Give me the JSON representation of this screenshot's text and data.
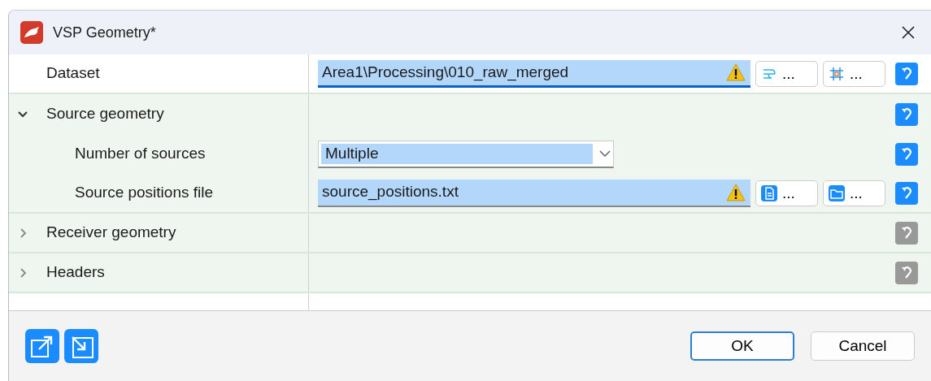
{
  "window": {
    "title": "VSP Geometry*"
  },
  "rows": [
    {
      "kind": "path",
      "label": "Dataset",
      "value": "Area1\\Processing\\010_raw_merged",
      "focused": true,
      "warning": true,
      "buttons": [
        {
          "kind": "filter",
          "label": "..."
        },
        {
          "kind": "crop",
          "label": "..."
        }
      ],
      "reset_enabled": true
    },
    {
      "kind": "group",
      "label": "Source geometry",
      "expanded": true,
      "reset_enabled": true,
      "children": [
        {
          "kind": "select",
          "label": "Number of sources",
          "value": "Multiple",
          "reset_enabled": true
        },
        {
          "kind": "path",
          "label": "Source positions file",
          "value": "source_positions.txt",
          "focused": false,
          "warning": true,
          "buttons": [
            {
              "kind": "file",
              "label": "..."
            },
            {
              "kind": "folder",
              "label": "..."
            }
          ],
          "reset_enabled": true
        }
      ]
    },
    {
      "kind": "group",
      "label": "Receiver geometry",
      "expanded": false,
      "reset_enabled": false,
      "children": []
    },
    {
      "kind": "group",
      "label": "Headers",
      "expanded": false,
      "reset_enabled": false,
      "children": []
    }
  ],
  "footer": {
    "icon_buttons": [
      {
        "kind": "export"
      },
      {
        "kind": "import"
      }
    ],
    "buttons": [
      {
        "label": "OK",
        "default": true
      },
      {
        "label": "Cancel",
        "default": false
      }
    ]
  }
}
